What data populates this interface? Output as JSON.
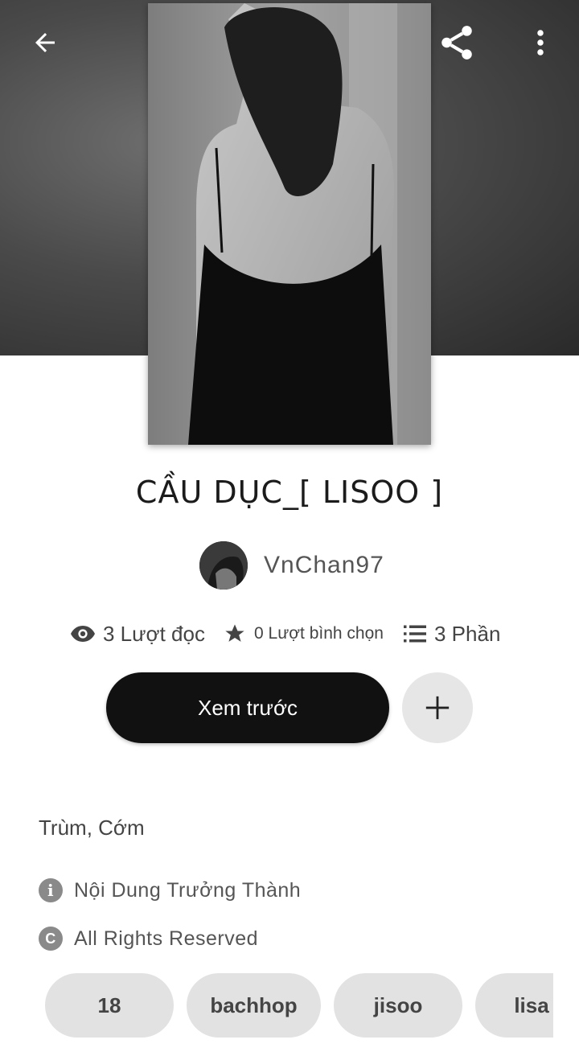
{
  "story": {
    "title": "CẦU DỤC_[ LISOO ]",
    "author": "VnChan97",
    "reads": "3 Lượt đọc",
    "votes": "0 Lượt bình chọn",
    "parts": "3 Phần",
    "description": "Trùm, Cớm",
    "mature": "Nội Dung Trưởng Thành",
    "copyright": "All Rights Reserved"
  },
  "actions": {
    "read_label": "Xem trước"
  },
  "tags": [
    "18",
    "bachhop",
    "jisoo",
    "lisa"
  ],
  "icons": {
    "back": "arrow-left-icon",
    "share": "share-icon",
    "more": "more-vertical-icon",
    "eye": "eye-icon",
    "star": "star-icon",
    "list": "list-icon",
    "plus": "plus-icon",
    "info": "info-icon",
    "copyright": "copyright-icon"
  }
}
